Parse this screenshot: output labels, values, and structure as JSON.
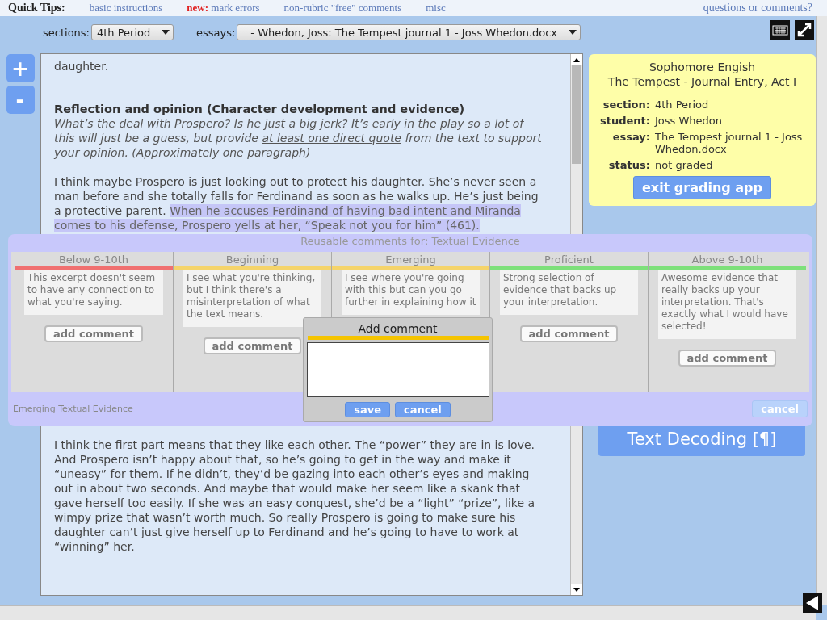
{
  "quick_tips": {
    "label": "Quick Tips:",
    "links": [
      {
        "text": "basic instructions"
      },
      {
        "prefix": "new:",
        "text": "mark errors"
      },
      {
        "text": "non-rubric \"free\" comments"
      },
      {
        "text": "misc"
      }
    ],
    "help_link": "questions or comments?"
  },
  "toolbar": {
    "sections_label": "sections:",
    "section_value": "4th Period",
    "essays_label": "essays:",
    "essay_value": "- Whedon, Joss: The Tempest journal 1 - Joss Whedon.docx"
  },
  "zoom_buttons": [
    "+",
    "-"
  ],
  "essay": {
    "paragraphs_above": [
      {
        "kind": "text",
        "text": "daughter."
      },
      {
        "kind": "heading",
        "text": "Reflection and opinion (Character development and evidence)"
      },
      {
        "kind": "prompt",
        "parts": [
          {
            "text": "What’s the deal with Prospero? Is he just a big jerk? It’s early in the play so a lot of this will just be a guess, but provide ",
            "underlined": false
          },
          {
            "text": "at least one direct quote",
            "underlined": true
          },
          {
            "text": " from the text to support your opinion. (Approximately one paragraph)",
            "underlined": false
          }
        ]
      },
      {
        "kind": "answer",
        "parts": [
          {
            "text": "I think maybe Prospero is just looking out to protect his daughter. She’s never seen a man before and she totally falls for Ferdinand as soon as he walks up. He’s just being a protective parent. ",
            "highlighted": false
          },
          {
            "text": "When he accuses Ferdinand of having bad intent and Miranda comes to his defense, Prospero yells at her, “Speak not you for him” (461).",
            "highlighted": true
          }
        ]
      }
    ],
    "paragraphs_below": [
      {
        "kind": "text",
        "text": "I think the first part means that they like each other. The “power” they are in is love. And Prospero isn’t happy about that, so he’s going to get in the way and make it “uneasy” for them. If he didn’t, they’d be gazing into each other’s eyes and making out in about two seconds. And maybe that would make her seem like a skank that gave herself too easily. If she was an easy conquest, she’d be a “light” “prize”, like a wimpy prize that wasn’t worth much. So really Prospero is going to make sure his daughter can’t just give herself up to Ferdinand and he’s going to have to work at “winning” her."
      }
    ]
  },
  "info_card": {
    "course": "Sophomore Engish",
    "assignment": "The Tempest - Journal Entry, Act I",
    "fields": [
      {
        "label": "section:",
        "value": "4th Period"
      },
      {
        "label": "student:",
        "value": "Joss Whedon"
      },
      {
        "label": "essay:",
        "value": "The Tempest journal 1 - Joss Whedon.docx"
      },
      {
        "label": "status:",
        "value": "not graded"
      }
    ],
    "button": "exit grading app"
  },
  "text_decoding_button": "Text Decoding [¶]",
  "rubric_overlay": {
    "title": "Reusable comments for: Textual Evidence",
    "columns": [
      {
        "level": "Below 9-10th",
        "color": "#f07070",
        "comment": "This excerpt doesn't seem to have any connection to what you're saying.",
        "button": "add comment"
      },
      {
        "level": "Beginning",
        "color": "#f5d46a",
        "comment": "I see what you're thinking, but I think there's a misinterpretation of what the text means.",
        "button": "add comment"
      },
      {
        "level": "Emerging",
        "color": "#f5d46a",
        "comment": "I see where you're going with this but can you go further in explaining how it"
      },
      {
        "level": "Proficient",
        "color": "#7de07a",
        "comment": "Strong selection of evidence that backs up your interpretation.",
        "button": "add comment"
      },
      {
        "level": "Above 9-10th",
        "color": "#7de07a",
        "comment": "Awesome evidence that really backs up your interpretation. That's exactly what I would have selected!",
        "button": "add comment"
      }
    ],
    "footer_label": "Emerging Textual Evidence",
    "cancel": "cancel"
  },
  "add_comment_dialog": {
    "title": "Add comment",
    "save": "save",
    "cancel": "cancel"
  }
}
